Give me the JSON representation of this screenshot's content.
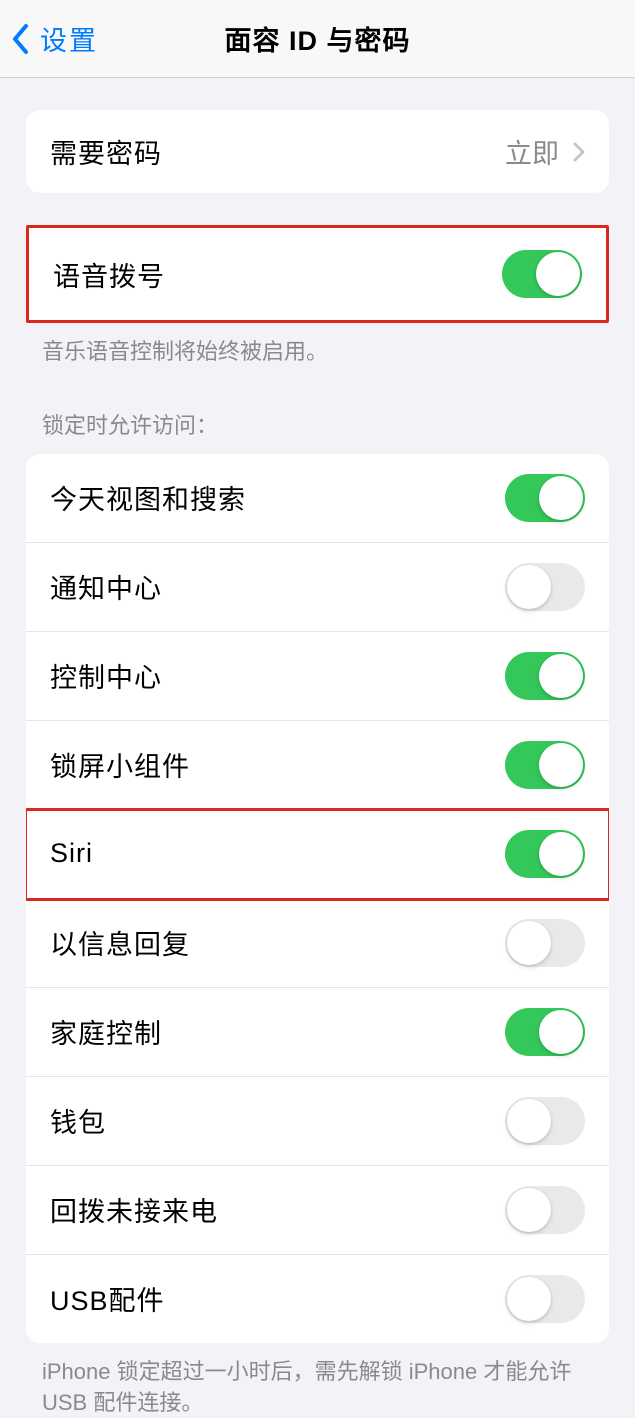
{
  "header": {
    "back_label": "设置",
    "title": "面容 ID 与密码"
  },
  "require_passcode": {
    "label": "需要密码",
    "value": "立即"
  },
  "voice_dial": {
    "label": "语音拨号",
    "on": true,
    "footer": "音乐语音控制将始终被启用。"
  },
  "lock_access": {
    "header": "锁定时允许访问：",
    "items": [
      {
        "label": "今天视图和搜索",
        "on": true
      },
      {
        "label": "通知中心",
        "on": false
      },
      {
        "label": "控制中心",
        "on": true
      },
      {
        "label": "锁屏小组件",
        "on": true
      },
      {
        "label": "Siri",
        "on": true,
        "highlight": true
      },
      {
        "label": "以信息回复",
        "on": false
      },
      {
        "label": "家庭控制",
        "on": true
      },
      {
        "label": "钱包",
        "on": false
      },
      {
        "label": "回拨未接来电",
        "on": false
      },
      {
        "label": "USB配件",
        "on": false
      }
    ],
    "footer": "iPhone 锁定超过一小时后，需先解锁 iPhone 才能允许USB 配件连接。"
  }
}
